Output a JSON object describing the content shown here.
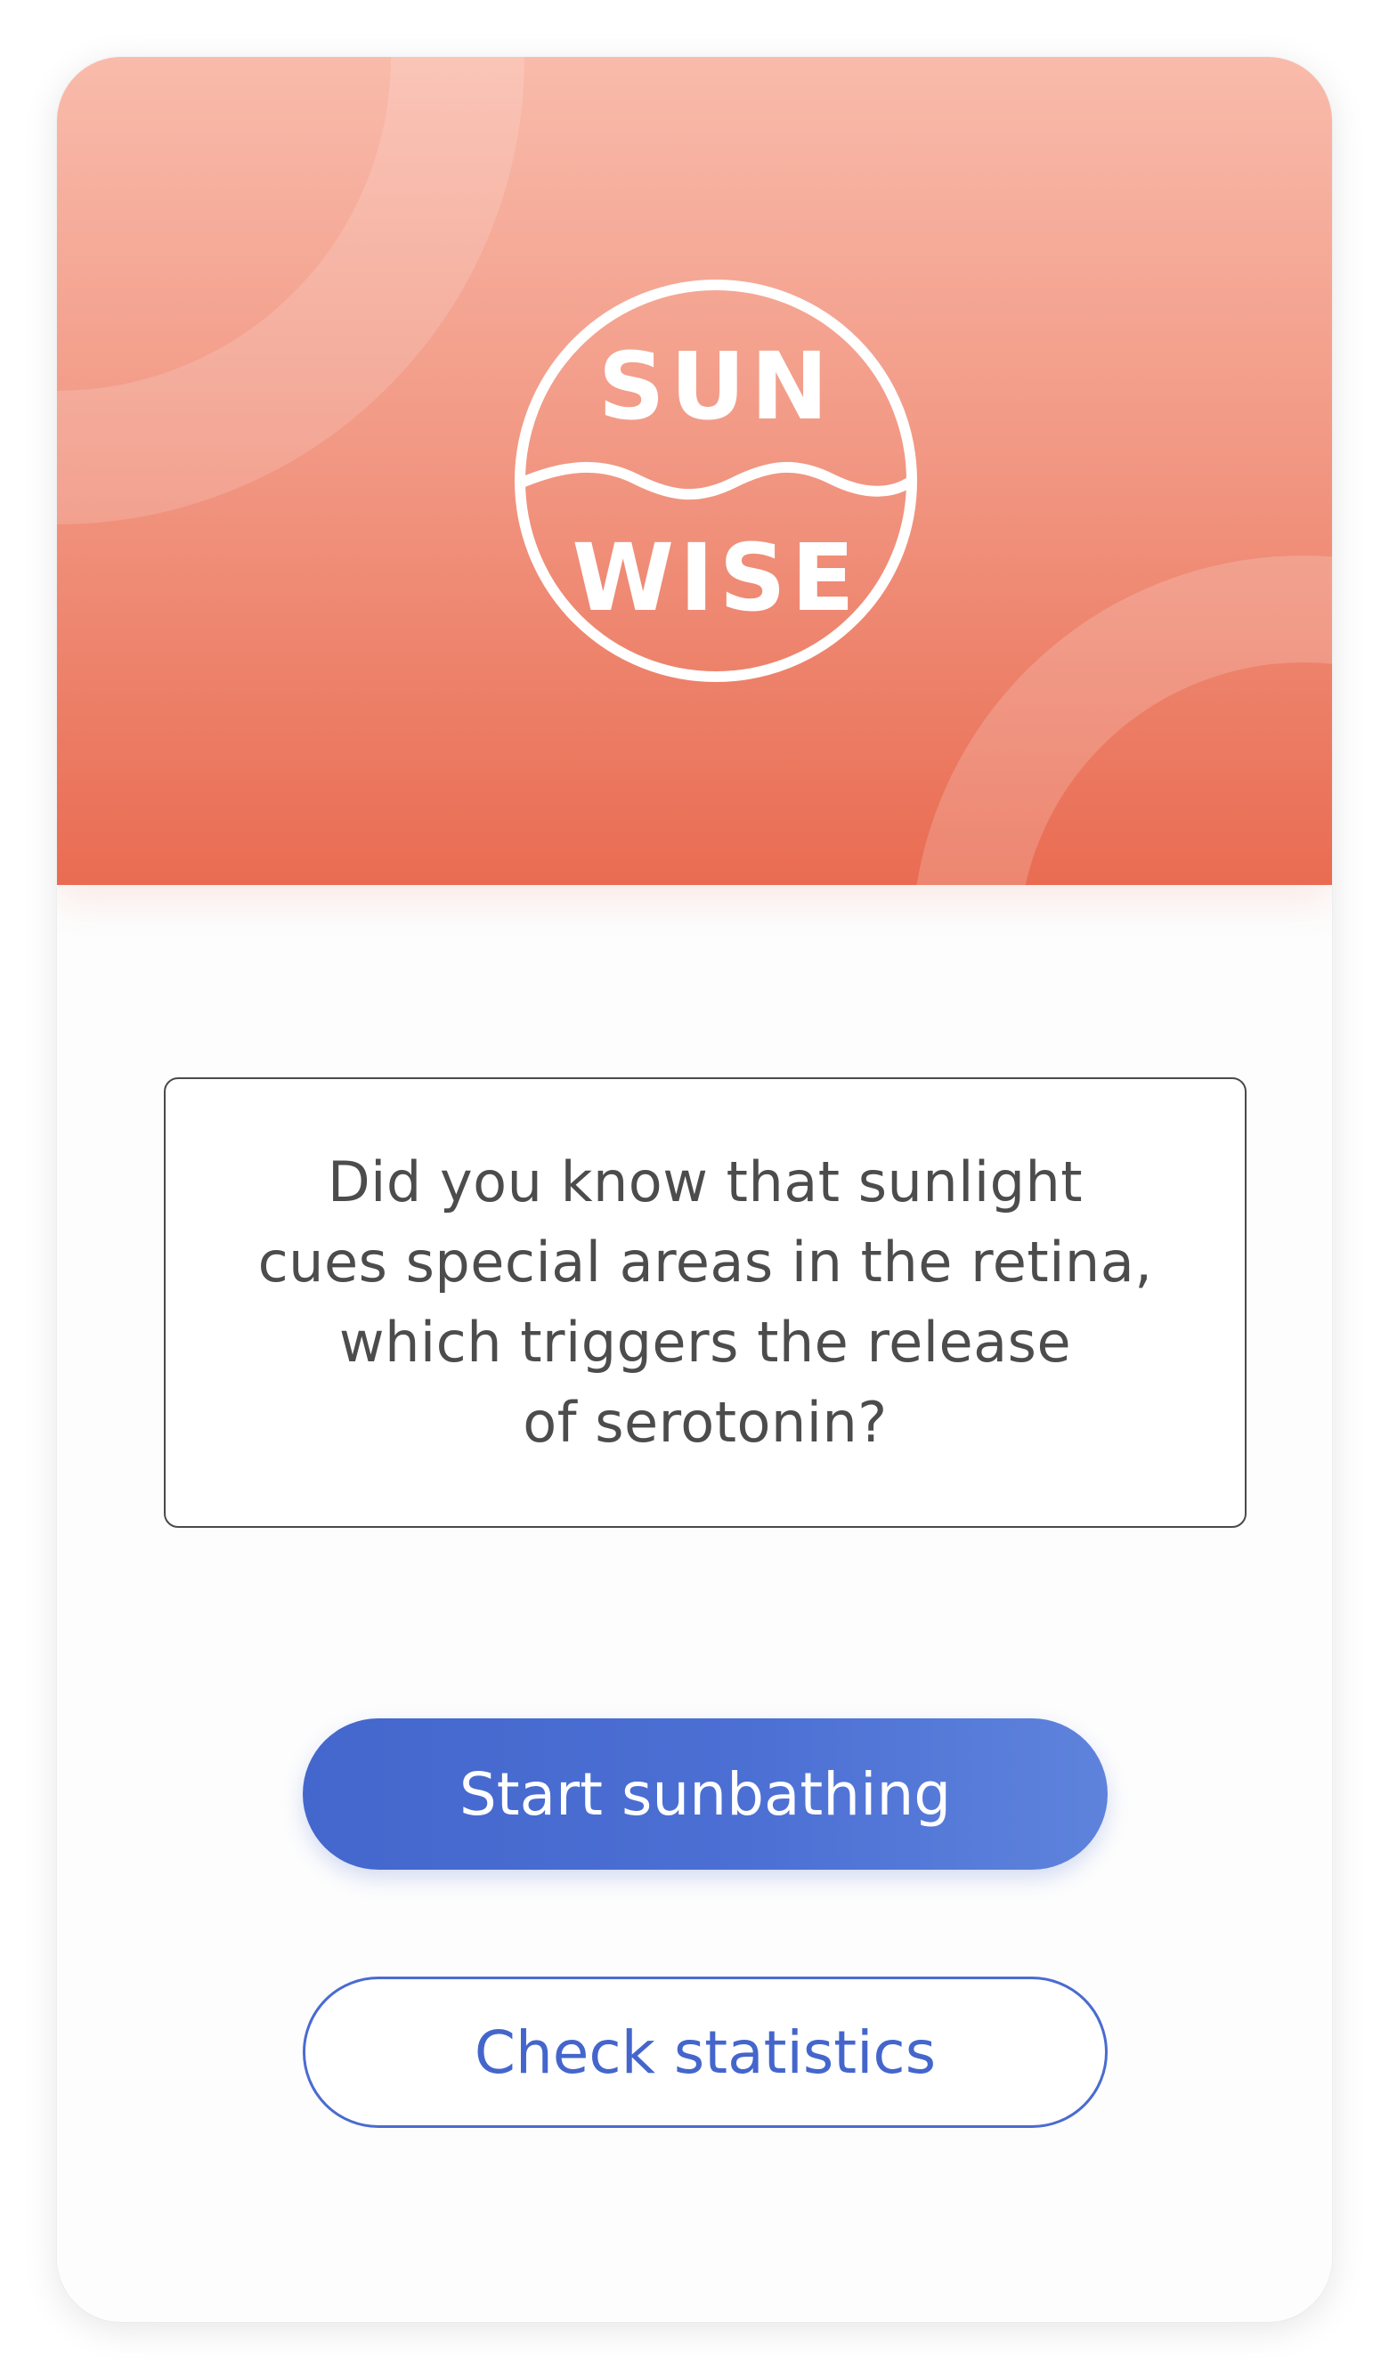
{
  "colors": {
    "hero_top": "#f9bbab",
    "hero_bottom": "#e96c52",
    "primary_accent": "#4467cd",
    "text_body": "#4c4c4c"
  },
  "logo": {
    "icon": "sunwise-logo-icon",
    "line1": "SUN",
    "line2": "WISE"
  },
  "fact": {
    "lines": [
      "Did you know that sunlight",
      "cues special areas in the retina,",
      "which triggers the release",
      "of serotonin?"
    ]
  },
  "actions": {
    "primary_label": "Start sunbathing",
    "secondary_label": "Check statistics"
  }
}
